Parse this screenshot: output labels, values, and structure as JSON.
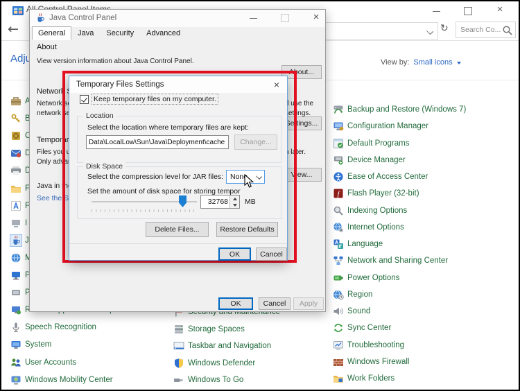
{
  "frame": {
    "title": "All Control Panel Items"
  },
  "toolbar": {
    "search_placeholder": "Search Co...",
    "view_by_label": "View by:",
    "view_by_value": "Small icons"
  },
  "heading": "Adjust your computer's settings",
  "java_window": {
    "title": "Java Control Panel",
    "tabs": [
      "General",
      "Java",
      "Security",
      "Advanced"
    ],
    "about_heading": "About",
    "about_text": "View version information about Java Control Panel.",
    "about_button": "About...",
    "network_heading": "Network Settings",
    "network_line1": "Network settings are used when making Internet connections. By default, Java will use the",
    "network_line2": "network settings in your web browser. Only advanced users should modify these settings.",
    "settings_button": "Settings...",
    "temp_heading": "Temporary Internet Files",
    "temp_line1": "Files you use in Java applications are stored in a special folder for quick execution later.",
    "temp_line2": "Only advanced users should delete files or modify these settings.",
    "view_button": "View...",
    "browser_enabled_text": "Java in the browser is enabled.",
    "security_link": "See the Security tab",
    "ok_button": "OK",
    "cancel_button": "Cancel",
    "apply_button": "Apply"
  },
  "dialog": {
    "title": "Temporary Files Settings",
    "keep_checkbox_label": "Keep temporary files on my computer.",
    "keep_checkbox_checked": true,
    "location_group": "Location",
    "location_label": "Select the location where temporary files are kept:",
    "location_value": "Data\\LocalLow\\Sun\\Java\\Deployment\\cache",
    "change_button": "Change...",
    "disk_group": "Disk Space",
    "compression_label": "Select the compression level for JAR files:",
    "compression_value": "None",
    "disk_amount_label": "Set the amount of disk space for storing tempor",
    "disk_size_value": "32768",
    "disk_size_unit": "MB",
    "delete_button": "Delete Files...",
    "restore_button": "Restore Defaults",
    "ok_button": "OK",
    "cancel_button": "Cancel"
  },
  "items": {
    "left": [
      {
        "label": "A",
        "icon": "admin-tools"
      },
      {
        "label": "B",
        "icon": "keys"
      },
      {
        "label": "C",
        "icon": "vault"
      },
      {
        "label": "D",
        "icon": "envelope"
      },
      {
        "label": "D",
        "icon": "printer"
      },
      {
        "label": "F",
        "icon": "folder"
      },
      {
        "label": "F",
        "icon": "fonts"
      },
      {
        "label": "I",
        "icon": "device"
      },
      {
        "label": "J",
        "icon": "java",
        "selected": true
      },
      {
        "label": "M",
        "icon": "globe"
      },
      {
        "label": "P",
        "icon": "monitor"
      },
      {
        "label": "P",
        "icon": "gray-device"
      },
      {
        "label": "RemoteApp and Desktop Connections",
        "icon": "remote-monitor"
      },
      {
        "label": "Speech Recognition",
        "icon": "microphone"
      },
      {
        "label": "System",
        "icon": "system-monitor"
      },
      {
        "label": "User Accounts",
        "icon": "users"
      },
      {
        "label": "Windows Mobility Center",
        "icon": "mobility"
      }
    ],
    "middle": [
      {
        "label": "Security and Maintenance",
        "icon": "flag"
      },
      {
        "label": "Storage Spaces",
        "icon": "storage"
      },
      {
        "label": "Taskbar and Navigation",
        "icon": "taskbar"
      },
      {
        "label": "Windows Defender",
        "icon": "shield"
      },
      {
        "label": "Windows To Go",
        "icon": "usb"
      }
    ],
    "right": [
      {
        "label": "Backup and Restore (Windows 7)",
        "icon": "backup"
      },
      {
        "label": "Configuration Manager",
        "icon": "config"
      },
      {
        "label": "Default Programs",
        "icon": "default-programs"
      },
      {
        "label": "Device Manager",
        "icon": "device-manager"
      },
      {
        "label": "Ease of Access Center",
        "icon": "ease"
      },
      {
        "label": "Flash Player (32-bit)",
        "icon": "flash"
      },
      {
        "label": "Indexing Options",
        "icon": "indexing"
      },
      {
        "label": "Internet Options",
        "icon": "internet"
      },
      {
        "label": "Language",
        "icon": "language"
      },
      {
        "label": "Network and Sharing Center",
        "icon": "network"
      },
      {
        "label": "Power Options",
        "icon": "power"
      },
      {
        "label": "Region",
        "icon": "region"
      },
      {
        "label": "Sound",
        "icon": "sound"
      },
      {
        "label": "Sync Center",
        "icon": "sync"
      },
      {
        "label": "Troubleshooting",
        "icon": "troubleshoot"
      },
      {
        "label": "Windows Firewall",
        "icon": "firewall"
      },
      {
        "label": "Work Folders",
        "icon": "work-folders"
      }
    ]
  },
  "colors": {
    "item_link_green": "#226b3c",
    "accent_blue": "#2b67c5",
    "highlight_red": "#e81123",
    "slider_blue": "#1b7fd4"
  }
}
